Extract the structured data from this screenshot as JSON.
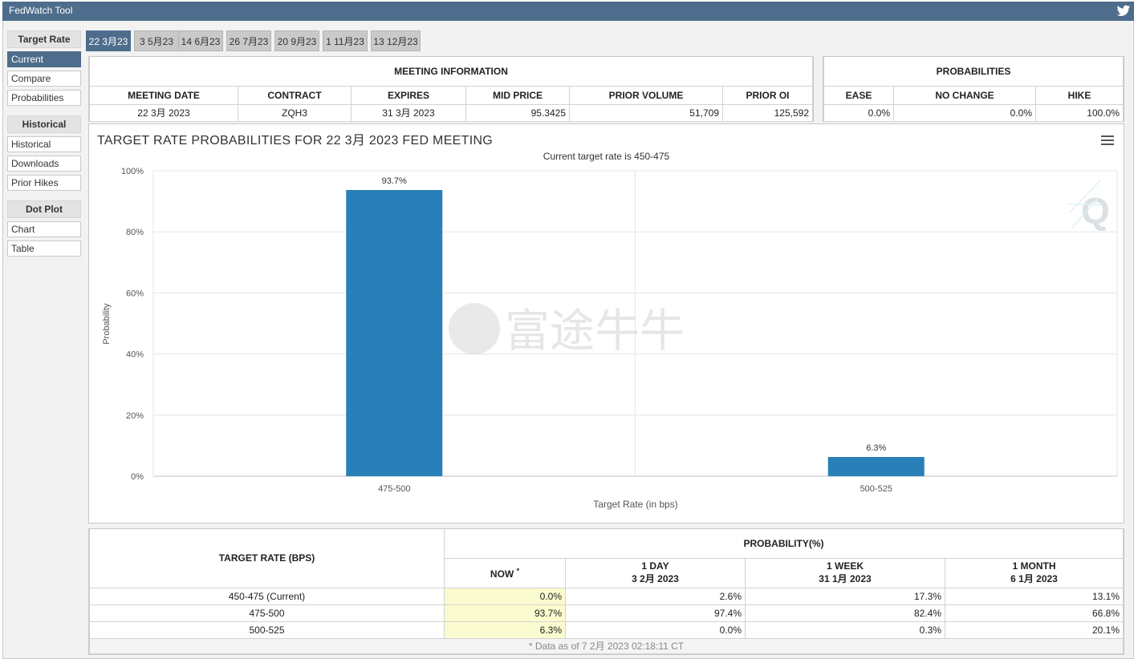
{
  "app": {
    "title": "FedWatch Tool",
    "twitter_icon": "twitter-icon"
  },
  "sidebar": {
    "sections": [
      {
        "title": "Target Rate",
        "items": [
          {
            "label": "Current",
            "active": true
          },
          {
            "label": "Compare"
          },
          {
            "label": "Probabilities"
          }
        ]
      },
      {
        "title": "Historical",
        "items": [
          {
            "label": "Historical"
          },
          {
            "label": "Downloads"
          },
          {
            "label": "Prior Hikes"
          }
        ]
      },
      {
        "title": "Dot Plot",
        "items": [
          {
            "label": "Chart"
          },
          {
            "label": "Table"
          }
        ]
      }
    ]
  },
  "tabs": [
    "22 3月23",
    "3 5月23",
    "14 6月23",
    "26 7月23",
    "20 9月23",
    "1 11月23",
    "13 12月23"
  ],
  "meeting_info": {
    "title": "MEETING INFORMATION",
    "headers": [
      "MEETING DATE",
      "CONTRACT",
      "EXPIRES",
      "MID PRICE",
      "PRIOR VOLUME",
      "PRIOR OI"
    ],
    "values": [
      "22 3月 2023",
      "ZQH3",
      "31 3月 2023",
      "95.3425",
      "51,709",
      "125,592"
    ]
  },
  "probabilities": {
    "title": "PROBABILITIES",
    "headers": [
      "EASE",
      "NO CHANGE",
      "HIKE"
    ],
    "values": [
      "0.0%",
      "0.0%",
      "100.0%"
    ]
  },
  "chart": {
    "menu_icon": "hamburger-menu-icon",
    "watermark_text": "富途牛牛",
    "watermark_icon": "futu-logo-icon",
    "brand_icon": "q-logo-icon",
    "bar_color": "#2980b9"
  },
  "chart_data": {
    "type": "bar",
    "title": "TARGET RATE PROBABILITIES FOR 22 3月 2023 FED MEETING",
    "subtitle": "Current target rate is 450-475",
    "xlabel": "Target Rate (in bps)",
    "ylabel": "Probability",
    "categories": [
      "475-500",
      "500-525"
    ],
    "values": [
      93.7,
      6.3
    ],
    "data_labels": [
      "93.7%",
      "6.3%"
    ],
    "ylim": [
      0,
      100
    ],
    "yticks": [
      "0%",
      "20%",
      "40%",
      "60%",
      "80%",
      "100%"
    ],
    "grid": true
  },
  "bottom_table": {
    "rate_header": "TARGET RATE (BPS)",
    "prob_header": "PROBABILITY(%)",
    "cols": [
      {
        "line1": "NOW",
        "line2": "",
        "star": "*"
      },
      {
        "line1": "1 DAY",
        "line2": "3 2月 2023"
      },
      {
        "line1": "1 WEEK",
        "line2": "31 1月 2023"
      },
      {
        "line1": "1 MONTH",
        "line2": "6 1月 2023"
      }
    ],
    "rows": [
      {
        "rate": "450-475 (Current)",
        "values": [
          "0.0%",
          "2.6%",
          "17.3%",
          "13.1%"
        ]
      },
      {
        "rate": "475-500",
        "values": [
          "93.7%",
          "97.4%",
          "82.4%",
          "66.8%"
        ]
      },
      {
        "rate": "500-525",
        "values": [
          "6.3%",
          "0.0%",
          "0.3%",
          "20.1%"
        ]
      }
    ],
    "footnote": "* Data as of 7 2月 2023 02:18:11 CT"
  }
}
